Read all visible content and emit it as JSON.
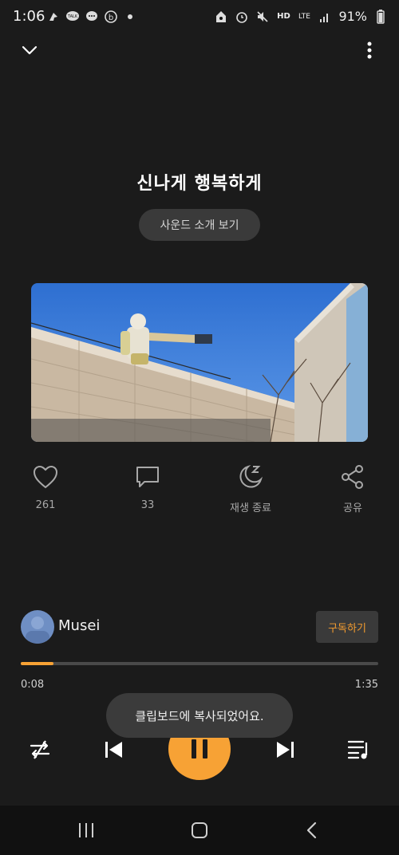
{
  "status_bar": {
    "time": "1:06",
    "battery_text": "91%",
    "network": "LTE",
    "hd_label": "HD"
  },
  "track": {
    "title": "신나게 행복하게",
    "sound_intro_label": "사운드 소개 보기"
  },
  "actions": [
    {
      "name": "like",
      "label": "261",
      "icon": "heart-icon"
    },
    {
      "name": "comment",
      "label": "33",
      "icon": "comment-icon"
    },
    {
      "name": "sleep-timer",
      "label": "재생 종료",
      "icon": "moon-sleep-icon"
    },
    {
      "name": "share",
      "label": "공유",
      "icon": "share-icon"
    }
  ],
  "artist": {
    "name": "Musei",
    "subscribe_label": "구독하기"
  },
  "player": {
    "current_time": "0:08",
    "total_time": "1:35",
    "progress": 0.091
  },
  "toast": {
    "message": "클립보드에 복사되었어요."
  },
  "colors": {
    "background": "#1b1b1b",
    "accent": "#f7a235"
  }
}
